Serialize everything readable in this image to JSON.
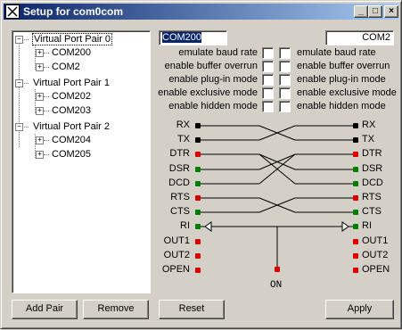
{
  "window": {
    "title": "Setup for com0com"
  },
  "tree": {
    "pairs": [
      {
        "label": "Virtual Port Pair 0",
        "ports": [
          "COM200",
          "COM2"
        ]
      },
      {
        "label": "Virtual Port Pair 1",
        "ports": [
          "COM202",
          "COM203"
        ]
      },
      {
        "label": "Virtual Port Pair 2",
        "ports": [
          "COM204",
          "COM205"
        ]
      }
    ]
  },
  "port_a": {
    "name": "COM200"
  },
  "port_b": {
    "name": "COM2"
  },
  "options": [
    "emulate baud rate",
    "enable buffer overrun",
    "enable plug-in mode",
    "enable exclusive mode",
    "enable hidden mode"
  ],
  "signals": {
    "left": [
      "RX",
      "TX",
      "DTR",
      "DSR",
      "DCD",
      "RTS",
      "CTS",
      "RI",
      "OUT1",
      "OUT2",
      "OPEN"
    ],
    "right": [
      "RX",
      "TX",
      "DTR",
      "DSR",
      "DCD",
      "RTS",
      "CTS",
      "RI",
      "OUT1",
      "OUT2",
      "OPEN"
    ],
    "on_label": "ON",
    "colors": {
      "black": "#000000",
      "red": "#e00000",
      "green": "#008000"
    }
  },
  "buttons": {
    "add_pair": "Add Pair",
    "remove": "Remove",
    "reset": "Reset",
    "apply": "Apply"
  },
  "titlebar_buttons": {
    "minimize": "_",
    "maximize": "□",
    "close": "×"
  }
}
